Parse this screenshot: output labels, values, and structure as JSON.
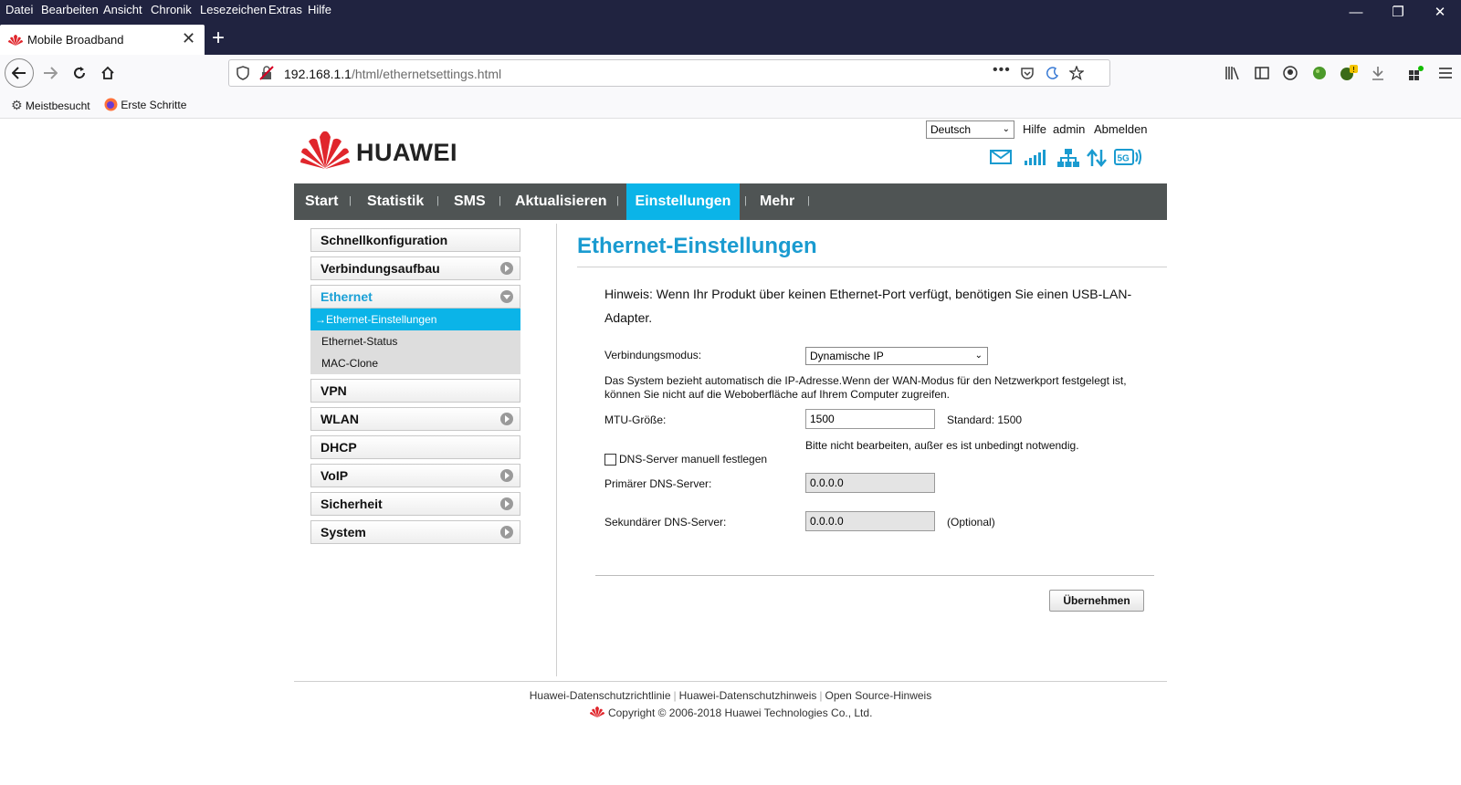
{
  "browser": {
    "menu": [
      "Datei",
      "Bearbeiten",
      "Ansicht",
      "Chronik",
      "Lesezeichen",
      "Extras",
      "Hilfe"
    ],
    "tab_title": "Mobile Broadband",
    "url_host": "192.168.1.1",
    "url_path": "/html/ethernetsettings.html",
    "bookmarks": [
      "Meistbesucht",
      "Erste Schritte"
    ]
  },
  "header": {
    "brand": "HUAWEI",
    "language": "Deutsch",
    "links": [
      "Hilfe",
      "admin",
      "Abmelden"
    ],
    "network_badge": "5G"
  },
  "nav": {
    "items": [
      "Start",
      "Statistik",
      "SMS",
      "Aktualisieren",
      "Einstellungen",
      "Mehr"
    ],
    "active": "Einstellungen"
  },
  "sidebar": {
    "items": [
      "Schnellkonfiguration",
      "Verbindungsaufbau",
      "Ethernet",
      "VPN",
      "WLAN",
      "DHCP",
      "VoIP",
      "Sicherheit",
      "System"
    ],
    "sub_items": [
      "Ethernet-Einstellungen",
      "Ethernet-Status",
      "MAC-Clone"
    ],
    "active_sub": "Ethernet-Einstellungen"
  },
  "content": {
    "title": "Ethernet-Einstellungen",
    "hint": "Hinweis: Wenn Ihr Produkt über keinen Ethernet-Port verfügt, benötigen Sie einen USB-LAN-Adapter.",
    "mode_label": "Verbindungsmodus:",
    "mode_value": "Dynamische IP",
    "mode_desc": "Das System bezieht automatisch die IP-Adresse.Wenn der WAN-Modus für den Netzwerkport festgelegt ist, können Sie nicht auf die Weboberfläche auf Ihrem Computer zugreifen.",
    "mtu_label": "MTU-Größe:",
    "mtu_value": "1500",
    "mtu_default": "Standard: 1500",
    "mtu_warning": "Bitte nicht bearbeiten, außer es ist unbedingt notwendig.",
    "dns_manual_label": "DNS-Server manuell festlegen",
    "dns_manual_checked": false,
    "dns1_label": "Primärer DNS-Server:",
    "dns1_value": "0.0.0.0",
    "dns2_label": "Sekundärer DNS-Server:",
    "dns2_value": "0.0.0.0",
    "optional": "(Optional)",
    "apply_button": "Übernehmen"
  },
  "footer": {
    "links": [
      "Huawei-Datenschutzrichtlinie",
      "Huawei-Datenschutzhinweis",
      "Open Source-Hinweis"
    ],
    "copyright": "Copyright © 2006-2018 Huawei Technologies Co., Ltd."
  },
  "colors": {
    "accent": "#0bb4e8",
    "title": "#1a9bd0",
    "nav_bg": "#4f5454",
    "chrome": "#202340",
    "huawei_red": "#e0262c"
  }
}
